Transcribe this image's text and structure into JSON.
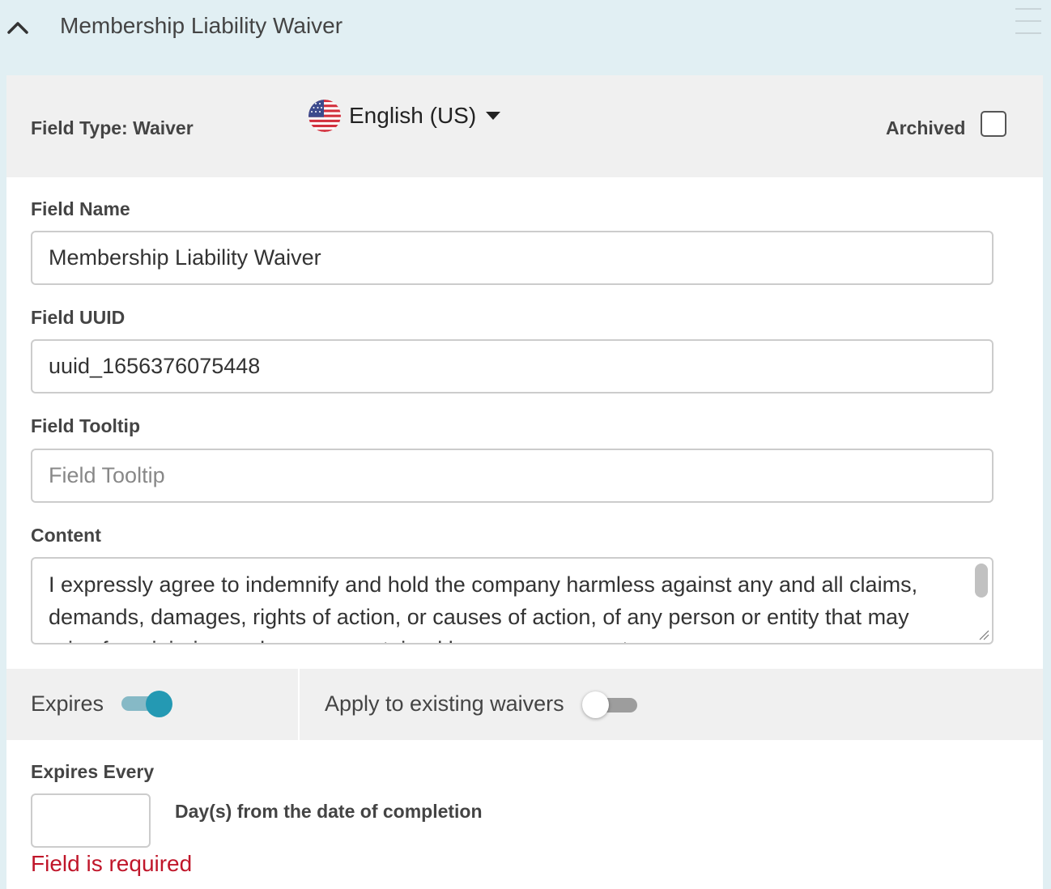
{
  "header": {
    "title": "Membership Liability Waiver"
  },
  "topbar": {
    "field_type": "Field Type: Waiver",
    "language": "English (US)",
    "archived_label": "Archived",
    "archived_checked": false
  },
  "form": {
    "field_name": {
      "label": "Field Name",
      "value": "Membership Liability Waiver"
    },
    "field_uuid": {
      "label": "Field UUID",
      "value": "uuid_1656376075448"
    },
    "field_tooltip": {
      "label": "Field Tooltip",
      "value": "",
      "placeholder": "Field Tooltip"
    },
    "content": {
      "label": "Content",
      "value": "I expressly agree to indemnify and hold the company harmless against any and all claims, demands, damages, rights of action, or causes of action, of any person or entity that may arise from injuries or damages sustained by me or my guests"
    }
  },
  "toggles": {
    "expires_label": "Expires",
    "expires_on": true,
    "apply_label": "Apply to existing waivers",
    "apply_on": false
  },
  "expires_every": {
    "label": "Expires Every",
    "value": "",
    "unit_label": "Day(s) from the date of completion",
    "error": "Field is required"
  },
  "colors": {
    "header_bg": "#e1eff3",
    "accent": "#2499b3",
    "error": "#c0162a"
  }
}
